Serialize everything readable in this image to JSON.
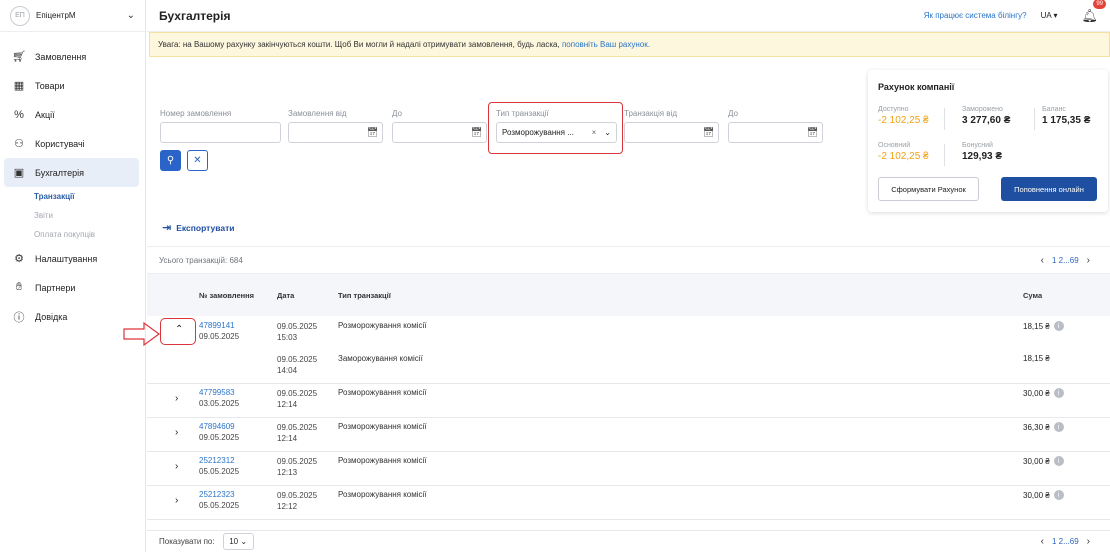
{
  "sidebar": {
    "avatar_initials": "ЕП",
    "company": "ЕпіцентрМ",
    "items": [
      {
        "label": "Замовлення",
        "icon": "cart-icon"
      },
      {
        "label": "Товари",
        "icon": "grid-icon"
      },
      {
        "label": "Акції",
        "icon": "discount-icon"
      },
      {
        "label": "Користувачі",
        "icon": "users-icon"
      },
      {
        "label": "Бухгалтерія",
        "icon": "wallet-icon",
        "active": true
      },
      {
        "label": "Налаштування",
        "icon": "settings-icon"
      },
      {
        "label": "Партнери",
        "icon": "handshake-icon"
      },
      {
        "label": "Довідка",
        "icon": "help-icon"
      }
    ],
    "subitems": [
      "Транзакції",
      "Звіти",
      "Оплата покупців"
    ]
  },
  "header": {
    "title": "Бухгалтерія",
    "help_link": "Як працює система білінгу?",
    "lang": "UA",
    "notifications": "99"
  },
  "alert": {
    "text": "Увага: на Вашому рахунку закінчуються кошти. Щоб Ви могли й надалі отримувати замовлення, будь ласка, ",
    "link": "поповніть Ваш рахунок."
  },
  "filters": {
    "order_number": "Номер замовлення",
    "order_from": "Замовлення від",
    "to1": "До",
    "tx_type": "Тип транзакції",
    "tx_type_value": "Розморожування ...",
    "tx_from": "Транзакція від",
    "to2": "До"
  },
  "account": {
    "title": "Рахунок компанії",
    "available_label": "Доступно",
    "available": "-2 102,25 ₴",
    "frozen_label": "Заморожено",
    "frozen": "3 277,60 ₴",
    "balance_label": "Баланс",
    "balance": "1 175,35 ₴",
    "main_label": "Основний",
    "main": "-2 102,25 ₴",
    "bonus_label": "Бонусний",
    "bonus": "129,93 ₴",
    "invoice_btn": "Сформувати Рахунок",
    "topup_btn": "Поповнення онлайн"
  },
  "export_label": "Експортувати",
  "table": {
    "total": "Усього транзакцій: 684",
    "pagination": "1  2...69",
    "headers": {
      "order": "№ замовлення",
      "date": "Дата",
      "type": "Тип транзакції",
      "sum": "Сума"
    },
    "rows": [
      {
        "order": "47899141",
        "order_date": "09.05.2025",
        "date": "09.05.2025",
        "time": "15:03",
        "type": "Розморожування комісії",
        "sum": "18,15 ₴"
      },
      {
        "date": "09.05.2025",
        "time": "14:04",
        "type": "Заморожування комісії",
        "sum": "18,15 ₴"
      },
      {
        "order": "47799583",
        "order_date": "03.05.2025",
        "date": "09.05.2025",
        "time": "12:14",
        "type": "Розморожування комісії",
        "sum": "30,00 ₴"
      },
      {
        "order": "47894609",
        "order_date": "09.05.2025",
        "date": "09.05.2025",
        "time": "12:14",
        "type": "Розморожування комісії",
        "sum": "36,30 ₴"
      },
      {
        "order": "25212312",
        "order_date": "05.05.2025",
        "date": "09.05.2025",
        "time": "12:13",
        "type": "Розморожування комісії",
        "sum": "30,00 ₴"
      },
      {
        "order": "25212323",
        "order_date": "05.05.2025",
        "date": "09.05.2025",
        "time": "12:12",
        "type": "Розморожування комісії",
        "sum": "30,00 ₴"
      }
    ]
  },
  "footer": {
    "show_label": "Показувати по:",
    "per_page": "10",
    "pagination": "1  2...69"
  }
}
